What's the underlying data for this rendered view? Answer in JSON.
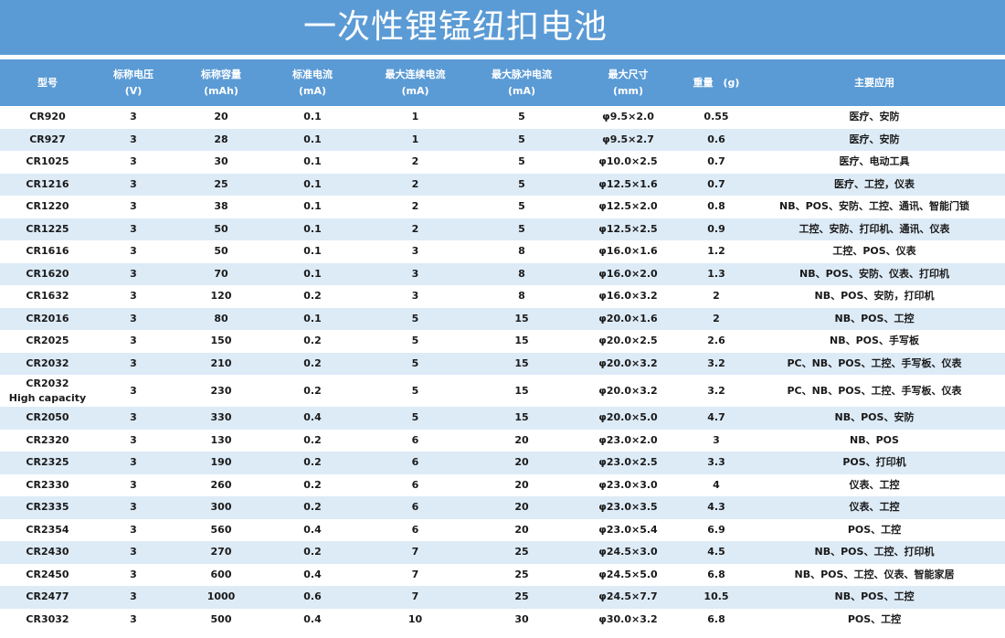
{
  "title": "一次性锂锰纽扣电池",
  "headers": [
    [
      "型号"
    ],
    [
      "标称电压",
      "(V)"
    ],
    [
      "标称容量",
      "(mAh)"
    ],
    [
      "标准电流",
      "(mA)"
    ],
    [
      "最大连续电流",
      "(mA)"
    ],
    [
      "最大脉冲电流",
      "(mA)"
    ],
    [
      "最大尺寸",
      "(mm)"
    ],
    [
      "重量　(g)"
    ],
    [
      "主要应用"
    ]
  ],
  "rows": [
    [
      [
        "CR920"
      ],
      "3",
      "20",
      "0.1",
      "1",
      "5",
      "φ9.5×2.0",
      "0.55",
      "医疗、安防"
    ],
    [
      [
        "CR927"
      ],
      "3",
      "28",
      "0.1",
      "1",
      "5",
      "φ9.5×2.7",
      "0.6",
      "医疗、安防"
    ],
    [
      [
        "CR1025"
      ],
      "3",
      "30",
      "0.1",
      "2",
      "5",
      "φ10.0×2.5",
      "0.7",
      "医疗、电动工具"
    ],
    [
      [
        "CR1216"
      ],
      "3",
      "25",
      "0.1",
      "2",
      "5",
      "φ12.5×1.6",
      "0.7",
      "医疗、工控，仪表"
    ],
    [
      [
        "CR1220"
      ],
      "3",
      "38",
      "0.1",
      "2",
      "5",
      "φ12.5×2.0",
      "0.8",
      "NB、POS、安防、工控、通讯、智能门锁"
    ],
    [
      [
        "CR1225"
      ],
      "3",
      "50",
      "0.1",
      "2",
      "5",
      "φ12.5×2.5",
      "0.9",
      "工控、安防、打印机、通讯、仪表"
    ],
    [
      [
        "CR1616"
      ],
      "3",
      "50",
      "0.1",
      "3",
      "8",
      "φ16.0×1.6",
      "1.2",
      "工控、POS、仪表"
    ],
    [
      [
        "CR1620"
      ],
      "3",
      "70",
      "0.1",
      "3",
      "8",
      "φ16.0×2.0",
      "1.3",
      "NB、POS、安防、仪表、打印机"
    ],
    [
      [
        "CR1632"
      ],
      "3",
      "120",
      "0.2",
      "3",
      "8",
      "φ16.0×3.2",
      "2",
      "NB、POS、安防，打印机"
    ],
    [
      [
        "CR2016"
      ],
      "3",
      "80",
      "0.1",
      "5",
      "15",
      "φ20.0×1.6",
      "2",
      "NB、POS、工控"
    ],
    [
      [
        "CR2025"
      ],
      "3",
      "150",
      "0.2",
      "5",
      "15",
      "φ20.0×2.5",
      "2.6",
      "NB、POS、手写板"
    ],
    [
      [
        "CR2032"
      ],
      "3",
      "210",
      "0.2",
      "5",
      "15",
      "φ20.0×3.2",
      "3.2",
      "PC、NB、POS、工控、手写板、仪表"
    ],
    [
      [
        "CR2032",
        "High capacity"
      ],
      "3",
      "230",
      "0.2",
      "5",
      "15",
      "φ20.0×3.2",
      "3.2",
      "PC、NB、POS、工控、手写板、仪表"
    ],
    [
      [
        "CR2050"
      ],
      "3",
      "330",
      "0.4",
      "5",
      "15",
      "φ20.0×5.0",
      "4.7",
      "NB、POS、安防"
    ],
    [
      [
        "CR2320"
      ],
      "3",
      "130",
      "0.2",
      "6",
      "20",
      "φ23.0×2.0",
      "3",
      "NB、POS"
    ],
    [
      [
        "CR2325"
      ],
      "3",
      "190",
      "0.2",
      "6",
      "20",
      "φ23.0×2.5",
      "3.3",
      "POS、打印机"
    ],
    [
      [
        "CR2330"
      ],
      "3",
      "260",
      "0.2",
      "6",
      "20",
      "φ23.0×3.0",
      "4",
      "仪表、工控"
    ],
    [
      [
        "CR2335"
      ],
      "3",
      "300",
      "0.2",
      "6",
      "20",
      "φ23.0×3.5",
      "4.3",
      "仪表、工控"
    ],
    [
      [
        "CR2354"
      ],
      "3",
      "560",
      "0.4",
      "6",
      "20",
      "φ23.0×5.4",
      "6.9",
      "POS、工控"
    ],
    [
      [
        "CR2430"
      ],
      "3",
      "270",
      "0.2",
      "7",
      "25",
      "φ24.5×3.0",
      "4.5",
      "NB、POS、工控、打印机"
    ],
    [
      [
        "CR2450"
      ],
      "3",
      "600",
      "0.4",
      "7",
      "25",
      "φ24.5×5.0",
      "6.8",
      "NB、POS、工控、仪表、智能家居"
    ],
    [
      [
        "CR2477"
      ],
      "3",
      "1000",
      "0.6",
      "7",
      "25",
      "φ24.5×7.7",
      "10.5",
      "NB、POS、工控"
    ],
    [
      [
        "CR3032"
      ],
      "3",
      "500",
      "0.4",
      "10",
      "30",
      "φ30.0×3.2",
      "6.8",
      "POS、工控"
    ]
  ]
}
